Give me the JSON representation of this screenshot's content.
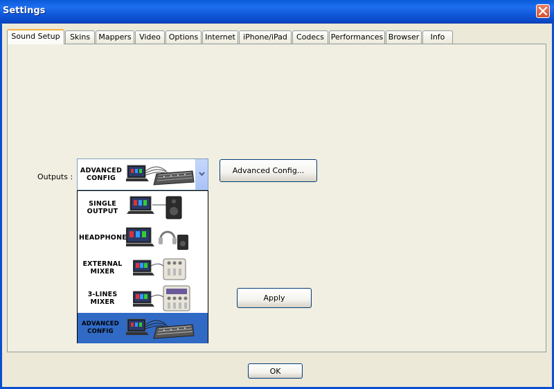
{
  "window": {
    "title": "Settings"
  },
  "tabs": [
    {
      "label": "Sound Setup",
      "active": true
    },
    {
      "label": "Skins"
    },
    {
      "label": "Mappers"
    },
    {
      "label": "Video"
    },
    {
      "label": "Options"
    },
    {
      "label": "Internet"
    },
    {
      "label": "iPhone/iPad"
    },
    {
      "label": "Codecs"
    },
    {
      "label": "Performances"
    },
    {
      "label": "Browser"
    },
    {
      "label": "Info"
    }
  ],
  "outputs": {
    "label": "Outputs :",
    "selected": {
      "line1": "ADVANCED",
      "line2": "CONFIG"
    },
    "options": [
      {
        "line1": "SINGLE",
        "line2": "OUTPUT",
        "icon": "laptop-speaker-icon"
      },
      {
        "line1": "HEADPHONES",
        "line2": "",
        "icon": "laptop-headphones-icon"
      },
      {
        "line1": "EXTERNAL",
        "line2": "MIXER",
        "icon": "laptop-external-mixer-icon"
      },
      {
        "line1": "3-LINES",
        "line2": "MIXER",
        "icon": "laptop-3lines-mixer-icon"
      },
      {
        "line1": "ADVANCED",
        "line2": "CONFIG",
        "icon": "laptop-advanced-mixer-icon",
        "selected": true
      }
    ]
  },
  "buttons": {
    "advanced_config": "Advanced Config...",
    "apply": "Apply",
    "ok": "OK"
  },
  "colors": {
    "selection": "#316ac5",
    "titlebar": "#0a5ad8",
    "tab_highlight": "#f7b041"
  }
}
